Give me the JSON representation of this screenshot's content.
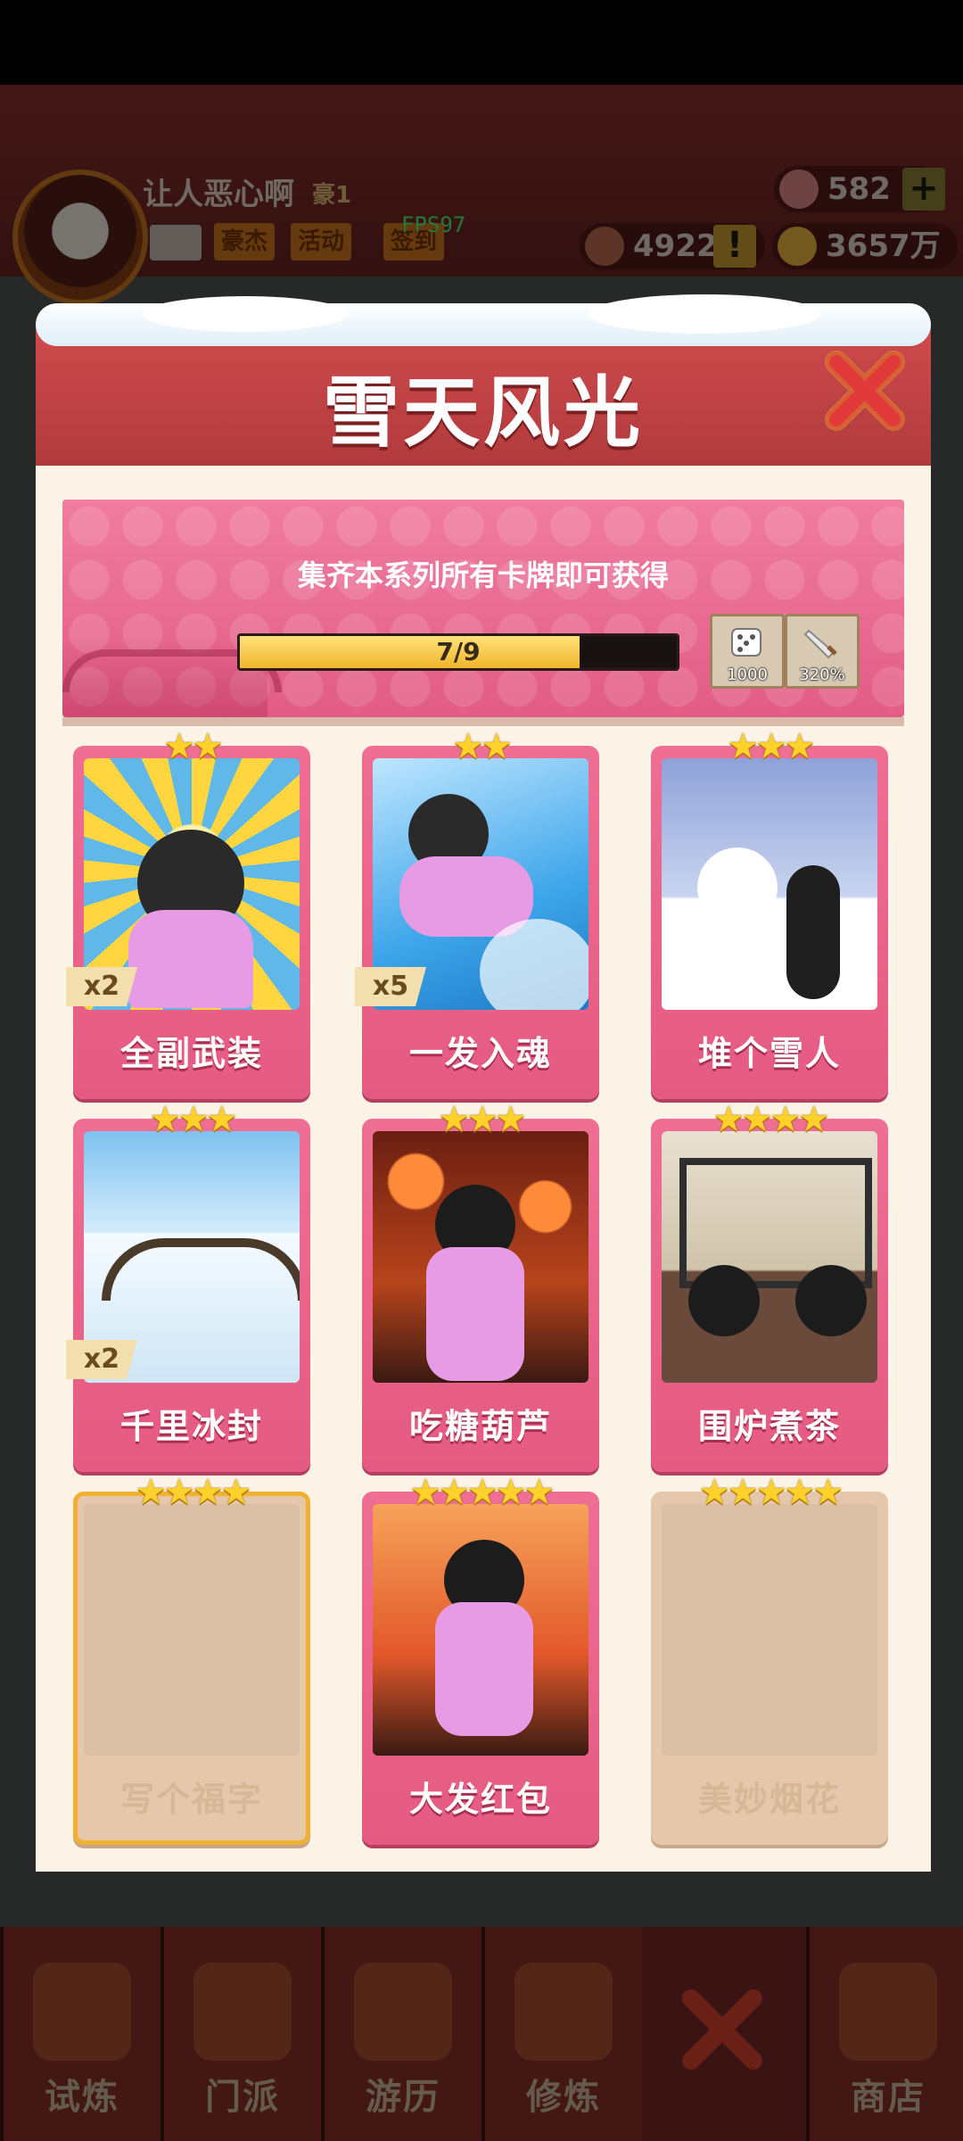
{
  "background": {
    "user": {
      "name": "让人恶心啊",
      "rank": "豪1"
    },
    "buttons": [
      "豪杰",
      "活动",
      "签到"
    ],
    "fps": "FPS97",
    "resources": {
      "gems": "582",
      "tickets": "4922",
      "coins": "3657万"
    },
    "bottom_nav": [
      "试炼",
      "门派",
      "游历",
      "修炼",
      "商店"
    ]
  },
  "modal": {
    "title": "雪天风光",
    "banner": {
      "text": "集齐本系列所有卡牌即可获得",
      "progress": {
        "text": "7/9",
        "current": 7,
        "total": 9
      },
      "rewards": [
        {
          "icon": "dice-icon",
          "label": "1000"
        },
        {
          "icon": "sword-icon",
          "label": "320%"
        }
      ]
    },
    "cards": [
      {
        "name": "全副武装",
        "stars": "★★",
        "count": "x2",
        "locked": false
      },
      {
        "name": "一发入魂",
        "stars": "★★",
        "count": "x5",
        "locked": false
      },
      {
        "name": "堆个雪人",
        "stars": "★★★",
        "count": "",
        "locked": false
      },
      {
        "name": "千里冰封",
        "stars": "★★★",
        "count": "x2",
        "locked": false
      },
      {
        "name": "吃糖葫芦",
        "stars": "★★★",
        "count": "",
        "locked": false
      },
      {
        "name": "围炉煮茶",
        "stars": "★★★★",
        "count": "",
        "locked": false
      },
      {
        "name": "写个福字",
        "stars": "★★★★",
        "count": "",
        "locked": true
      },
      {
        "name": "大发红包",
        "stars": "★★★★★",
        "count": "",
        "locked": false
      },
      {
        "name": "美妙烟花",
        "stars": "★★★★★",
        "count": "",
        "locked": true
      }
    ]
  },
  "colors": {
    "header": "#c8444a",
    "card": "#ea6389",
    "star": "#ffd12a",
    "progress": "#f0b52a"
  }
}
